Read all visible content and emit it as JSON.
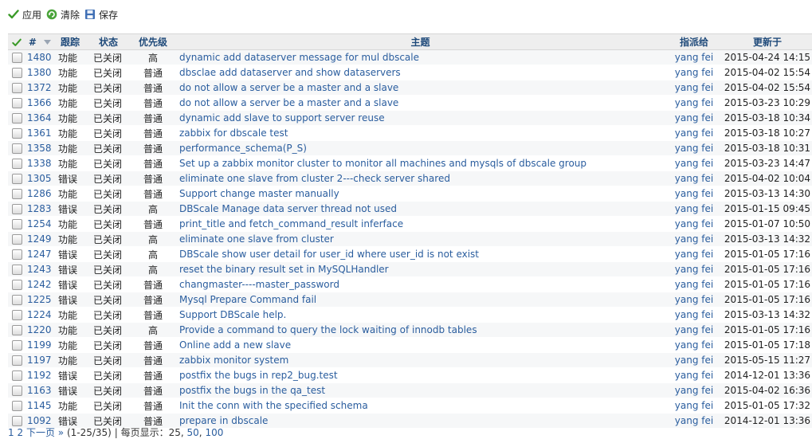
{
  "toolbar": {
    "apply": "应用",
    "clear": "清除",
    "save": "保存"
  },
  "colors": {
    "link": "#2a5d9e",
    "header_text": "#1f4a7a",
    "check_green": "#3a9a28",
    "clear_green": "#4aa43a",
    "save_blue": "#3f6fb5"
  },
  "columns": {
    "id": "#",
    "tracker": "跟踪",
    "status": "状态",
    "priority": "优先级",
    "subject": "主题",
    "assignee": "指派给",
    "updated": "更新于"
  },
  "issues": [
    {
      "id": "1480",
      "tracker": "功能",
      "status": "已关闭",
      "priority": "高",
      "subject": "dynamic add dataserver message for mul dbscale",
      "assignee": "yang fei",
      "updated": "2015-04-24 14:15"
    },
    {
      "id": "1380",
      "tracker": "功能",
      "status": "已关闭",
      "priority": "普通",
      "subject": "dbsclae add dataserver and show dataservers",
      "assignee": "yang fei",
      "updated": "2015-04-02 15:54"
    },
    {
      "id": "1372",
      "tracker": "功能",
      "status": "已关闭",
      "priority": "普通",
      "subject": "do not allow a server be a master and a slave",
      "assignee": "yang fei",
      "updated": "2015-04-02 15:54"
    },
    {
      "id": "1366",
      "tracker": "功能",
      "status": "已关闭",
      "priority": "普通",
      "subject": "do not allow a server be a master and a slave",
      "assignee": "yang fei",
      "updated": "2015-03-23 10:29"
    },
    {
      "id": "1364",
      "tracker": "功能",
      "status": "已关闭",
      "priority": "普通",
      "subject": "dynamic add slave to support server reuse",
      "assignee": "yang fei",
      "updated": "2015-03-18 10:34"
    },
    {
      "id": "1361",
      "tracker": "功能",
      "status": "已关闭",
      "priority": "普通",
      "subject": "zabbix for dbscale test",
      "assignee": "yang fei",
      "updated": "2015-03-18 10:27"
    },
    {
      "id": "1358",
      "tracker": "功能",
      "status": "已关闭",
      "priority": "普通",
      "subject": "performance_schema(P_S)",
      "assignee": "yang fei",
      "updated": "2015-03-18 10:31"
    },
    {
      "id": "1338",
      "tracker": "功能",
      "status": "已关闭",
      "priority": "普通",
      "subject": "Set up a zabbix monitor cluster to monitor all machines and mysqls of dbscale group",
      "assignee": "yang fei",
      "updated": "2015-03-23 14:47"
    },
    {
      "id": "1305",
      "tracker": "错误",
      "status": "已关闭",
      "priority": "普通",
      "subject": "eliminate one slave from cluster 2---check server shared",
      "assignee": "yang fei",
      "updated": "2015-04-02 10:04"
    },
    {
      "id": "1286",
      "tracker": "功能",
      "status": "已关闭",
      "priority": "普通",
      "subject": "Support change master manually",
      "assignee": "yang fei",
      "updated": "2015-03-13 14:30"
    },
    {
      "id": "1283",
      "tracker": "错误",
      "status": "已关闭",
      "priority": "高",
      "subject": "DBScale Manage data server thread not used",
      "assignee": "yang fei",
      "updated": "2015-01-15 09:45"
    },
    {
      "id": "1254",
      "tracker": "功能",
      "status": "已关闭",
      "priority": "普通",
      "subject": "print_title and fetch_command_result inferface",
      "assignee": "yang fei",
      "updated": "2015-01-07 10:50"
    },
    {
      "id": "1249",
      "tracker": "功能",
      "status": "已关闭",
      "priority": "高",
      "subject": "eliminate one slave from cluster",
      "assignee": "yang fei",
      "updated": "2015-03-13 14:32"
    },
    {
      "id": "1247",
      "tracker": "错误",
      "status": "已关闭",
      "priority": "高",
      "subject": "DBScale show user detail for user_id where user_id is not exist",
      "assignee": "yang fei",
      "updated": "2015-01-05 17:16"
    },
    {
      "id": "1243",
      "tracker": "错误",
      "status": "已关闭",
      "priority": "高",
      "subject": "reset the binary result set in MySQLHandler",
      "assignee": "yang fei",
      "updated": "2015-01-05 17:16"
    },
    {
      "id": "1242",
      "tracker": "错误",
      "status": "已关闭",
      "priority": "普通",
      "subject": "changmaster----master_password",
      "assignee": "yang fei",
      "updated": "2015-01-05 17:16"
    },
    {
      "id": "1225",
      "tracker": "错误",
      "status": "已关闭",
      "priority": "普通",
      "subject": "Mysql Prepare Command fail",
      "assignee": "yang fei",
      "updated": "2015-01-05 17:16"
    },
    {
      "id": "1224",
      "tracker": "功能",
      "status": "已关闭",
      "priority": "普通",
      "subject": "Support DBScale help.",
      "assignee": "yang fei",
      "updated": "2015-03-13 14:32"
    },
    {
      "id": "1220",
      "tracker": "功能",
      "status": "已关闭",
      "priority": "高",
      "subject": "Provide a command to query the lock waiting of innodb tables",
      "assignee": "yang fei",
      "updated": "2015-01-05 17:16"
    },
    {
      "id": "1199",
      "tracker": "功能",
      "status": "已关闭",
      "priority": "普通",
      "subject": "Online add a new slave",
      "assignee": "yang fei",
      "updated": "2015-01-05 17:18"
    },
    {
      "id": "1197",
      "tracker": "功能",
      "status": "已关闭",
      "priority": "普通",
      "subject": "zabbix monitor system",
      "assignee": "yang fei",
      "updated": "2015-05-15 11:27"
    },
    {
      "id": "1192",
      "tracker": "错误",
      "status": "已关闭",
      "priority": "普通",
      "subject": "postfix the bugs in rep2_bug.test",
      "assignee": "yang fei",
      "updated": "2014-12-01 13:36"
    },
    {
      "id": "1163",
      "tracker": "错误",
      "status": "已关闭",
      "priority": "普通",
      "subject": "postfix the bugs in the qa_test",
      "assignee": "yang fei",
      "updated": "2015-04-02 16:36"
    },
    {
      "id": "1145",
      "tracker": "功能",
      "status": "已关闭",
      "priority": "普通",
      "subject": "Init the conn with the specified schema",
      "assignee": "yang fei",
      "updated": "2015-01-05 17:32"
    },
    {
      "id": "1092",
      "tracker": "错误",
      "status": "已关闭",
      "priority": "普通",
      "subject": "prepare in dbscale",
      "assignee": "yang fei",
      "updated": "2014-12-01 13:36"
    }
  ],
  "pagination": {
    "page1": "1",
    "page2": "2",
    "next": "下一页 »",
    "range": "(1-25/35)",
    "sep": "|",
    "per_page_label": "每页显示：",
    "opt25": "25",
    "comma": ",",
    "opt50": "50",
    "opt100": "100"
  }
}
